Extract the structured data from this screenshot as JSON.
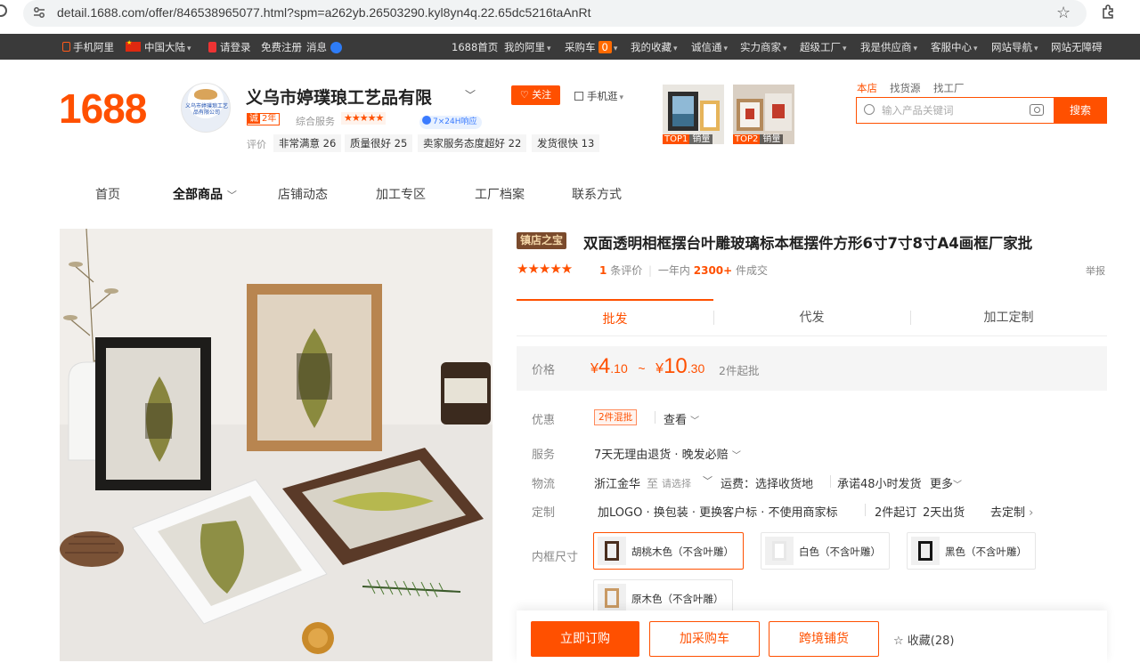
{
  "browser": {
    "url": "detail.1688.com/offer/846538965077.html?spm=a262yb.26503290.kyl8yn4q.22.65dc5216taAnRt"
  },
  "topbar": {
    "left": [
      "手机阿里",
      "中国大陆",
      "请登录",
      "免费注册",
      "消息"
    ],
    "home": "1688首页",
    "my_ali": "我的阿里",
    "cart": "采购车",
    "cart_count": "0",
    "favorites": "我的收藏",
    "trust": "诚信通",
    "merchants": "实力商家",
    "factory": "超级工厂",
    "supplier": "我是供应商",
    "service": "客服中心",
    "sitenav": "网站导航",
    "barrier_free": "网站无障碍"
  },
  "shop": {
    "logo": "1688",
    "avatar_text": "义乌市婷璞琅工艺品有限公司",
    "name": "义乌市婷璞琅工艺品有限",
    "follow": "关注",
    "mobile": "手机逛",
    "year_badge_icon": "诚",
    "year_badge": "2年",
    "service_label": "综合服务",
    "service_stars": "★★★★★",
    "service_24": "7×24H响应",
    "eval_label": "评价",
    "eval_tags": [
      "非常满意 26",
      "质量很好 25",
      "卖家服务态度超好 22",
      "发货很快 13"
    ],
    "top_items": [
      {
        "rank": "TOP1",
        "label": "销量"
      },
      {
        "rank": "TOP2",
        "label": "销量"
      }
    ]
  },
  "search": {
    "scopes": [
      "本店",
      "找货源",
      "找工厂"
    ],
    "placeholder": "输入产品关键词",
    "button": "搜索"
  },
  "shop_nav": [
    "首页",
    "全部商品",
    "店铺动态",
    "加工专区",
    "工厂档案",
    "联系方式"
  ],
  "product": {
    "badge": "镇店之宝",
    "title": "双面透明相框摆台叶雕玻璃标本框摆件方形6寸7寸8寸A4画框厂家批",
    "stars": "★★★★★",
    "review_count": "1",
    "review_text": "条评价",
    "year_label": "一年内",
    "sold": "2300+",
    "sold_text": "件成交",
    "report": "举报"
  },
  "trade_tabs": [
    "批发",
    "代发",
    "加工定制"
  ],
  "price": {
    "label": "价格",
    "low_int": "4",
    "low_dec": ".10",
    "high_int": "10",
    "high_dec": ".30",
    "currency": "¥",
    "tilde": "~",
    "min_order": "2件起批"
  },
  "attrs": {
    "discount_label": "优惠",
    "discount_badge": "2件混批",
    "discount_view": "查看",
    "service_label": "服务",
    "service_value": "7天无理由退货 · 晚发必赔",
    "logistics_label": "物流",
    "origin": "浙江金华",
    "to": "至",
    "choose": "请选择",
    "freight": "运费：选择收货地",
    "promise": "承诺48小时发货",
    "more": "更多",
    "custom_label": "定制",
    "custom_value": "加LOGO · 换包装 · 更换客户标 · 不使用商家标",
    "custom_moq": "2件起订",
    "custom_days": "2天出货",
    "custom_link": "去定制",
    "size_label": "内框尺寸"
  },
  "size_options": [
    "胡桃木色（不含叶雕）",
    "白色（不含叶雕）",
    "黑色（不含叶雕）",
    "原木色（不含叶雕）"
  ],
  "actions": {
    "buy": "立即订购",
    "cart": "加采购车",
    "cross": "跨境铺货",
    "fav": "收藏(28)"
  },
  "colors": {
    "brand_orange": "#ff5000",
    "topbar_bg": "#3a3a3a",
    "badge_brown": "#7a4a2c"
  }
}
